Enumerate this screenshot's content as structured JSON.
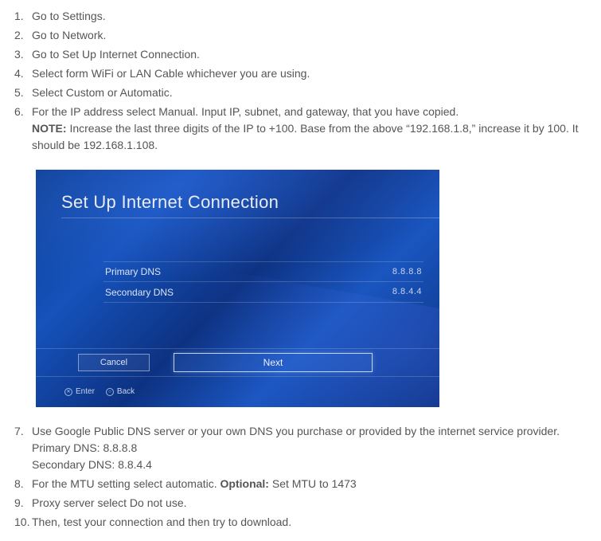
{
  "list": {
    "i1": "Go to Settings.",
    "i2": "Go to Network.",
    "i3": "Go to Set Up Internet Connection.",
    "i4": "Select form WiFi or LAN Cable whichever you are using.",
    "i5": "Select Custom or Automatic.",
    "i6a": "For the IP address select Manual. Input IP, subnet, and gateway, that you have copied.",
    "i6_note_label": "NOTE:",
    "i6_note_text": " Increase the last three digits of the IP to +100. Base from the above “192.168.1.8,” increase it by 100. It should be 192.168.1.108.",
    "i7a": "Use Google Public DNS server or your own DNS you purchase or provided by the internet service provider.",
    "i7b": "Primary DNS: 8.8.8.8",
    "i7c": "Secondary DNS: 8.8.4.4",
    "i8a": "For the MTU setting select automatic. ",
    "i8_opt_label": "Optional:",
    "i8_opt_text": " Set MTU to 1473",
    "i9": "Proxy server select Do not use.",
    "i10": "Then, test your connection and then try to download."
  },
  "shot": {
    "title": "Set Up Internet Connection",
    "primary_label": "Primary DNS",
    "primary_val": "8.8.8.8",
    "secondary_label": "Secondary DNS",
    "secondary_val": "8.8.4.4",
    "cancel": "Cancel",
    "next": "Next",
    "enter": "Enter",
    "back": "Back"
  }
}
